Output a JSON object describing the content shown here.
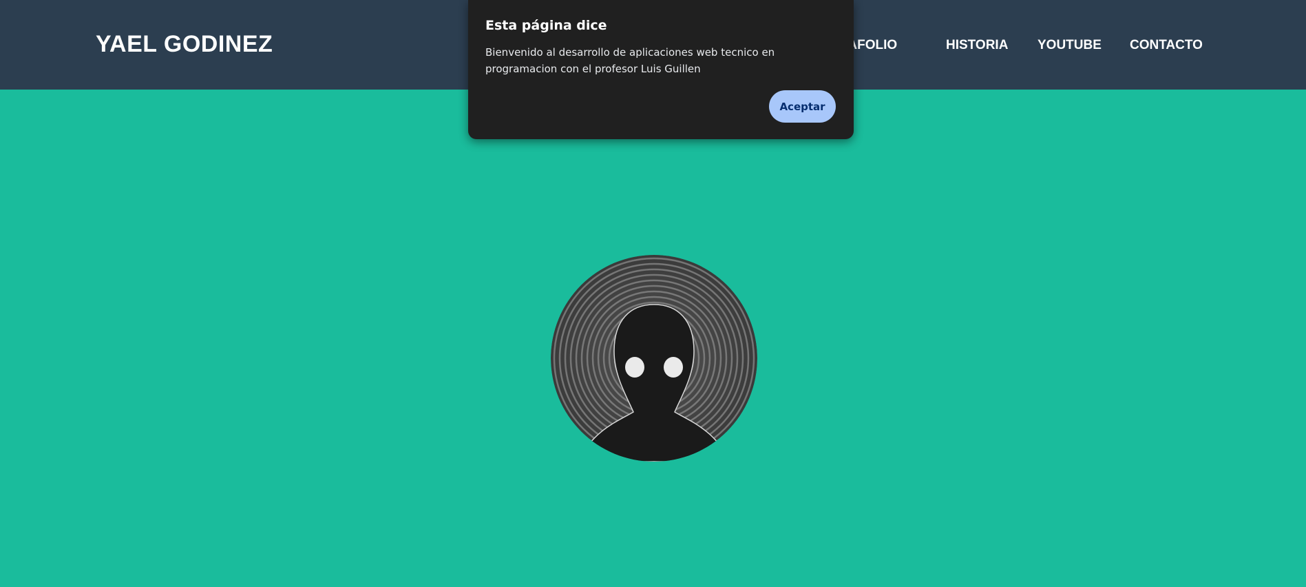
{
  "header": {
    "brand": "YAEL GODINEZ",
    "nav": [
      {
        "label": "PORTAFOLIO"
      },
      {
        "label": "HISTORIA"
      },
      {
        "label": "YOUTUBE"
      },
      {
        "label": "CONTACTO"
      }
    ]
  },
  "main": {
    "avatar_icon": "hooded-figure-avatar"
  },
  "dialog": {
    "title": "Esta página dice",
    "message": "Bienvenido al desarrollo de aplicaciones web tecnico en programacion con el profesor Luis Guillen",
    "ok_label": "Aceptar"
  },
  "colors": {
    "header_bg": "#2c3e50",
    "page_bg": "#1abc9c",
    "dialog_bg": "#202020",
    "button_bg": "#a8c7fa"
  }
}
